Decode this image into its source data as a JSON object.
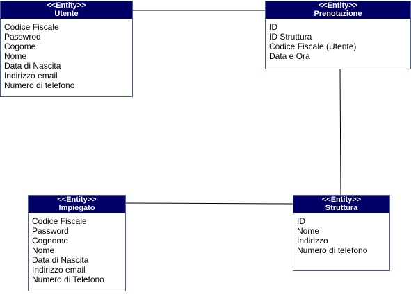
{
  "entities": {
    "utente": {
      "stereotype": "<<Entity>>",
      "name": "Utente",
      "attributes": [
        "Codice Fiscale",
        "Passwrod",
        "Cogome",
        "Nome",
        "Data di Nascita",
        "Indirizzo email",
        "Numero di telefono"
      ]
    },
    "prenotazione": {
      "stereotype": "<<Entity>>",
      "name": "Prenotazione",
      "attributes": [
        "ID",
        "ID Struttura",
        "Codice Fiscale (Utente)",
        "Data e Ora"
      ]
    },
    "impiegato": {
      "stereotype": "<<Entity>>",
      "name": "Impiegato",
      "attributes": [
        "Codice Fiscale",
        "Password",
        "Cognome",
        "Nome",
        "Data di Nascita",
        "Indirizzo email",
        "Numero di Telefono"
      ]
    },
    "struttura": {
      "stereotype": "<<Entity>>",
      "name": "Struttura",
      "attributes": [
        "ID",
        "Nome",
        "Indirizzo",
        "Numero di telefono"
      ]
    }
  },
  "colors": {
    "header_bg": "#000066",
    "header_text": "#ffffff",
    "border": "#4a5f8a",
    "connector": "#000000"
  }
}
